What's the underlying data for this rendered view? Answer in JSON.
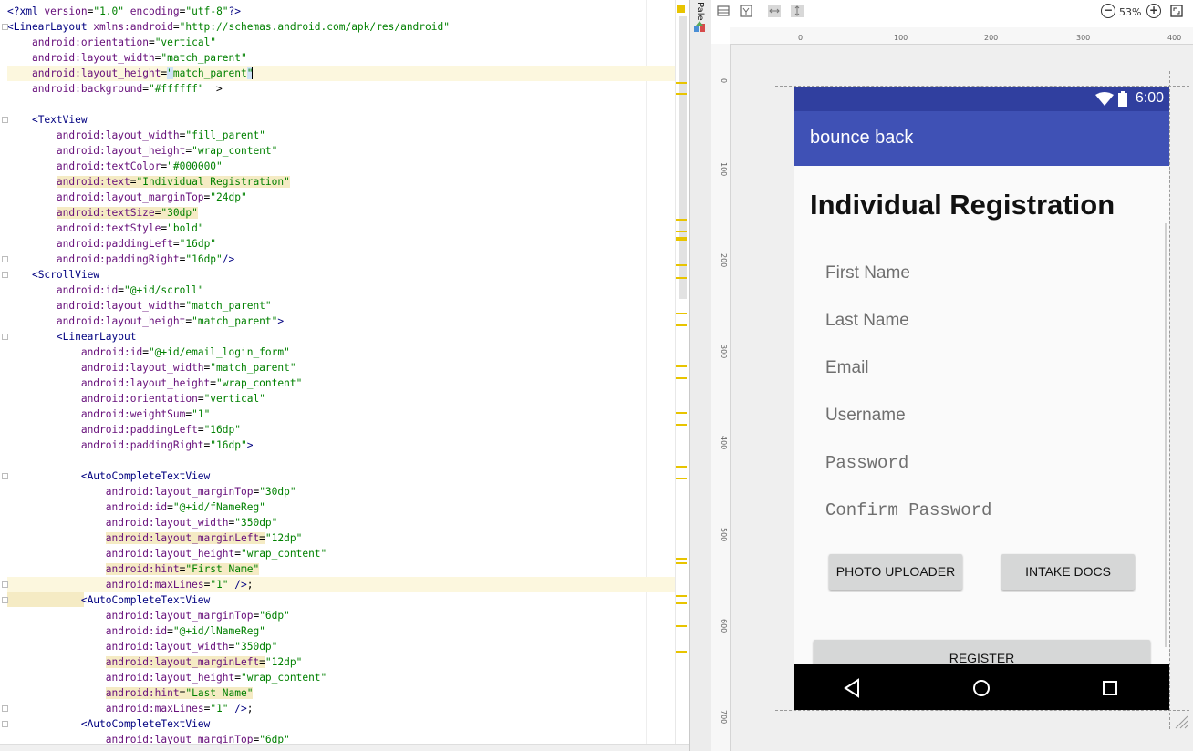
{
  "editor": {
    "lines": [
      [
        [
          "tag",
          "<?xml "
        ],
        [
          "attr",
          "version"
        ],
        [
          "br",
          "="
        ],
        [
          "str",
          "\"1.0\" "
        ],
        [
          "attr",
          "encoding"
        ],
        [
          "br",
          "="
        ],
        [
          "str",
          "\"utf-8\""
        ],
        [
          "tag",
          "?>"
        ]
      ],
      [
        [
          "tag",
          "<LinearLayout "
        ],
        [
          "attr",
          "xmlns:android"
        ],
        [
          "br",
          "="
        ],
        [
          "str",
          "\"http://schemas.android.com/apk/res/android\""
        ]
      ],
      [
        [
          "br",
          "    "
        ],
        [
          "attr",
          "android:orientation"
        ],
        [
          "br",
          "="
        ],
        [
          "str",
          "\"vertical\""
        ]
      ],
      [
        [
          "br",
          "    "
        ],
        [
          "attr",
          "android:layout_width"
        ],
        [
          "br",
          "="
        ],
        [
          "str",
          "\"match_parent\""
        ]
      ],
      [
        [
          "br",
          "    "
        ],
        [
          "attr",
          "android:layout_height"
        ],
        [
          "br",
          "="
        ],
        [
          "sel",
          "\""
        ],
        [
          "str",
          "match_parent"
        ],
        [
          "sel",
          "\""
        ],
        [
          "caret",
          ""
        ]
      ],
      [
        [
          "br",
          "    "
        ],
        [
          "attr",
          "android:background"
        ],
        [
          "br",
          "="
        ],
        [
          "str",
          "\"#ffffff\""
        ],
        [
          "br",
          "  >"
        ]
      ],
      [
        [
          "br",
          ""
        ]
      ],
      [
        [
          "br",
          "    "
        ],
        [
          "tag",
          "<TextView"
        ]
      ],
      [
        [
          "br",
          "        "
        ],
        [
          "attr",
          "android:layout_width"
        ],
        [
          "br",
          "="
        ],
        [
          "str",
          "\"fill_parent\""
        ]
      ],
      [
        [
          "br",
          "        "
        ],
        [
          "attr",
          "android:layout_height"
        ],
        [
          "br",
          "="
        ],
        [
          "str",
          "\"wrap_content\""
        ]
      ],
      [
        [
          "br",
          "        "
        ],
        [
          "attr",
          "android:textColor"
        ],
        [
          "br",
          "="
        ],
        [
          "str",
          "\"#000000\""
        ]
      ],
      [
        [
          "br",
          "        "
        ],
        [
          "mattr",
          "android:text"
        ],
        [
          "mbr",
          "="
        ],
        [
          "mstr",
          "\"Individual Registration\""
        ]
      ],
      [
        [
          "br",
          "        "
        ],
        [
          "attr",
          "android:layout_marginTop"
        ],
        [
          "br",
          "="
        ],
        [
          "str",
          "\"24dp\""
        ]
      ],
      [
        [
          "br",
          "        "
        ],
        [
          "mattr",
          "android:textSize"
        ],
        [
          "mbr",
          "="
        ],
        [
          "mstr",
          "\"30dp\""
        ]
      ],
      [
        [
          "br",
          "        "
        ],
        [
          "attr",
          "android:textStyle"
        ],
        [
          "br",
          "="
        ],
        [
          "str",
          "\"bold\""
        ]
      ],
      [
        [
          "br",
          "        "
        ],
        [
          "attr",
          "android:paddingLeft"
        ],
        [
          "br",
          "="
        ],
        [
          "str",
          "\"16dp\""
        ]
      ],
      [
        [
          "br",
          "        "
        ],
        [
          "attr",
          "android:paddingRight"
        ],
        [
          "br",
          "="
        ],
        [
          "str",
          "\"16dp\""
        ],
        [
          "tag",
          "/>"
        ]
      ],
      [
        [
          "br",
          "    "
        ],
        [
          "tag",
          "<ScrollView"
        ]
      ],
      [
        [
          "br",
          "        "
        ],
        [
          "attr",
          "android:id"
        ],
        [
          "br",
          "="
        ],
        [
          "str",
          "\"@+id/scroll\""
        ]
      ],
      [
        [
          "br",
          "        "
        ],
        [
          "attr",
          "android:layout_width"
        ],
        [
          "br",
          "="
        ],
        [
          "str",
          "\"match_parent\""
        ]
      ],
      [
        [
          "br",
          "        "
        ],
        [
          "attr",
          "android:layout_height"
        ],
        [
          "br",
          "="
        ],
        [
          "str",
          "\"match_parent\""
        ],
        [
          "tag",
          ">"
        ]
      ],
      [
        [
          "br",
          "        "
        ],
        [
          "tag",
          "<LinearLayout"
        ]
      ],
      [
        [
          "br",
          "            "
        ],
        [
          "attr",
          "android:id"
        ],
        [
          "br",
          "="
        ],
        [
          "str",
          "\"@+id/email_login_form\""
        ]
      ],
      [
        [
          "br",
          "            "
        ],
        [
          "attr",
          "android:layout_width"
        ],
        [
          "br",
          "="
        ],
        [
          "str",
          "\"match_parent\""
        ]
      ],
      [
        [
          "br",
          "            "
        ],
        [
          "attr",
          "android:layout_height"
        ],
        [
          "br",
          "="
        ],
        [
          "str",
          "\"wrap_content\""
        ]
      ],
      [
        [
          "br",
          "            "
        ],
        [
          "attr",
          "android:orientation"
        ],
        [
          "br",
          "="
        ],
        [
          "str",
          "\"vertical\""
        ]
      ],
      [
        [
          "br",
          "            "
        ],
        [
          "attr",
          "android:weightSum"
        ],
        [
          "br",
          "="
        ],
        [
          "str",
          "\"1\""
        ]
      ],
      [
        [
          "br",
          "            "
        ],
        [
          "attr",
          "android:paddingLeft"
        ],
        [
          "br",
          "="
        ],
        [
          "str",
          "\"16dp\""
        ]
      ],
      [
        [
          "br",
          "            "
        ],
        [
          "attr",
          "android:paddingRight"
        ],
        [
          "br",
          "="
        ],
        [
          "str",
          "\"16dp\""
        ],
        [
          "tag",
          ">"
        ]
      ],
      [
        [
          "br",
          ""
        ]
      ],
      [
        [
          "br",
          "            "
        ],
        [
          "tag",
          "<AutoCompleteTextView"
        ]
      ],
      [
        [
          "br",
          "                "
        ],
        [
          "attr",
          "android:layout_marginTop"
        ],
        [
          "br",
          "="
        ],
        [
          "str",
          "\"30dp\""
        ]
      ],
      [
        [
          "br",
          "                "
        ],
        [
          "attr",
          "android:id"
        ],
        [
          "br",
          "="
        ],
        [
          "str",
          "\"@+id/fNameReg\""
        ]
      ],
      [
        [
          "br",
          "                "
        ],
        [
          "attr",
          "android:layout_width"
        ],
        [
          "br",
          "="
        ],
        [
          "str",
          "\"350dp\""
        ]
      ],
      [
        [
          "br",
          "                "
        ],
        [
          "mattr",
          "android:layout_marginLeft"
        ],
        [
          "mbr",
          "="
        ],
        [
          "str",
          "\"12dp\""
        ]
      ],
      [
        [
          "br",
          "                "
        ],
        [
          "attr",
          "android:layout_height"
        ],
        [
          "br",
          "="
        ],
        [
          "str",
          "\"wrap_content\""
        ]
      ],
      [
        [
          "br",
          "                "
        ],
        [
          "mattr",
          "android:hint"
        ],
        [
          "mbr",
          "="
        ],
        [
          "mstr",
          "\"First Name\""
        ]
      ],
      [
        [
          "br",
          "                "
        ],
        [
          "attr",
          "android:maxLines"
        ],
        [
          "br",
          "="
        ],
        [
          "str",
          "\"1\" "
        ],
        [
          "tag",
          "/>"
        ],
        [
          "br",
          ";"
        ]
      ],
      [
        [
          "br",
          "            "
        ],
        [
          "tag",
          "<AutoCompleteTextView"
        ]
      ],
      [
        [
          "br",
          "                "
        ],
        [
          "attr",
          "android:layout_marginTop"
        ],
        [
          "br",
          "="
        ],
        [
          "str",
          "\"6dp\""
        ]
      ],
      [
        [
          "br",
          "                "
        ],
        [
          "attr",
          "android:id"
        ],
        [
          "br",
          "="
        ],
        [
          "str",
          "\"@+id/lNameReg\""
        ]
      ],
      [
        [
          "br",
          "                "
        ],
        [
          "attr",
          "android:layout_width"
        ],
        [
          "br",
          "="
        ],
        [
          "str",
          "\"350dp\""
        ]
      ],
      [
        [
          "br",
          "                "
        ],
        [
          "mattr",
          "android:layout_marginLeft"
        ],
        [
          "mbr",
          "="
        ],
        [
          "str",
          "\"12dp\""
        ]
      ],
      [
        [
          "br",
          "                "
        ],
        [
          "attr",
          "android:layout_height"
        ],
        [
          "br",
          "="
        ],
        [
          "str",
          "\"wrap_content\""
        ]
      ],
      [
        [
          "br",
          "                "
        ],
        [
          "mattr",
          "android:hint"
        ],
        [
          "mbr",
          "="
        ],
        [
          "mstr",
          "\"Last Name\""
        ]
      ],
      [
        [
          "br",
          "                "
        ],
        [
          "attr",
          "android:maxLines"
        ],
        [
          "br",
          "="
        ],
        [
          "str",
          "\"1\" "
        ],
        [
          "tag",
          "/>"
        ],
        [
          "br",
          ";"
        ]
      ],
      [
        [
          "br",
          "            "
        ],
        [
          "tag",
          "<AutoCompleteTextView"
        ]
      ],
      [
        [
          "br",
          "                "
        ],
        [
          "attr",
          "android:layout_marginTop"
        ],
        [
          "br",
          "="
        ],
        [
          "str",
          "\"6dp\""
        ]
      ]
    ],
    "highlighted_lines": [
      4,
      37
    ]
  },
  "palette": {
    "label": "Pale"
  },
  "toolbar": {
    "zoom": "53%"
  },
  "ruler": {
    "top_ticks": [
      "0",
      "100",
      "200",
      "300",
      "400"
    ],
    "left_ticks": [
      "0",
      "100",
      "200",
      "300",
      "400",
      "500",
      "600",
      "700"
    ]
  },
  "device": {
    "time": "6:00",
    "app_title": "bounce back",
    "heading": "Individual Registration",
    "hints": [
      "First Name",
      "Last Name",
      "Email",
      "Username",
      "Password",
      "Confirm Password"
    ],
    "buttons": {
      "photo": "PHOTO UPLOADER",
      "intake": "INTAKE DOCS",
      "register": "REGISTER"
    }
  },
  "colors": {
    "status_bar": "#303f9f",
    "app_bar": "#3f51b5",
    "button": "#d6d7d7",
    "tag": "#000080",
    "attribute": "#660e7a",
    "string": "#008000"
  }
}
